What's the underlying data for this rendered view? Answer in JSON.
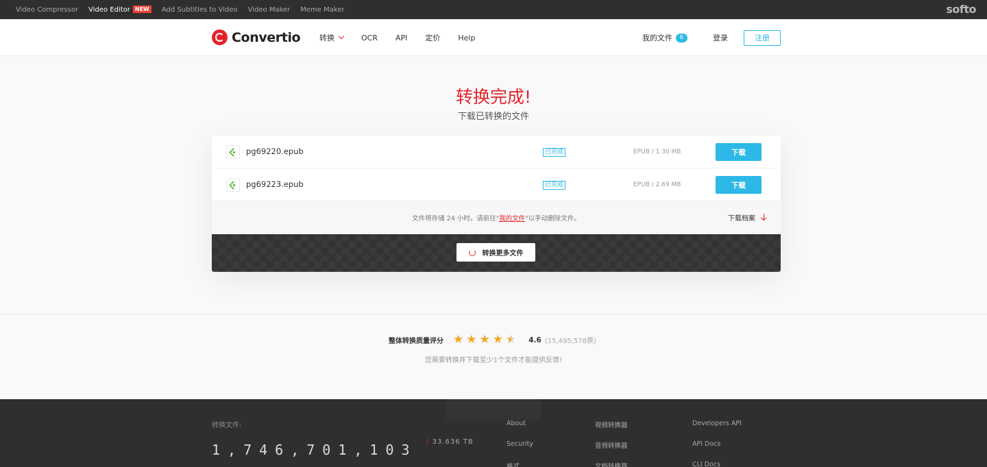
{
  "topbar": {
    "links": [
      "Video Compressor",
      "Video Editor",
      "Add Subtitles to Video",
      "Video Maker",
      "Meme Maker"
    ],
    "new_badge": "NEW",
    "brand": "softo"
  },
  "header": {
    "logo_text": "Convertio",
    "nav": [
      "转换",
      "OCR",
      "API",
      "定价",
      "Help"
    ],
    "my_files_label": "我的文件",
    "my_files_count": "6",
    "login": "登录",
    "register": "注册"
  },
  "hero": {
    "title": "转换完成!",
    "subtitle": "下载已转换的文件"
  },
  "files": [
    {
      "name": "pg69220.epub",
      "status": "已完成",
      "size": "EPUB / 1.30 MB",
      "download": "下载"
    },
    {
      "name": "pg69223.epub",
      "status": "已完成",
      "size": "EPUB / 2.69 MB",
      "download": "下载"
    }
  ],
  "info": {
    "before": "文件将存储 24 小时。请前往",
    "link": "我的文件",
    "after": "以手动删除文件。",
    "archive": "下载档案"
  },
  "convert_more": "转换更多文件",
  "rating": {
    "label": "整体转换质量评分",
    "stars": 4.5,
    "score": "4.6",
    "votes": "(15,495,578票)",
    "note": "您需要转换并下载至少1个文件才能提供反馈!"
  },
  "footer": {
    "label": "转换文件:",
    "count": "1,746,701,103",
    "tb_slash": "/",
    "tb": "33.636 TB",
    "col1": [
      "About",
      "Security",
      "格式"
    ],
    "col2": [
      "视频转换器",
      "音频转换器",
      "文档转换器"
    ],
    "col3": [
      "Developers API",
      "API Docs",
      "CLI Docs"
    ]
  },
  "colors": {
    "accent": "#e3242b",
    "blue": "#2db8e8",
    "star": "#f5a623"
  }
}
